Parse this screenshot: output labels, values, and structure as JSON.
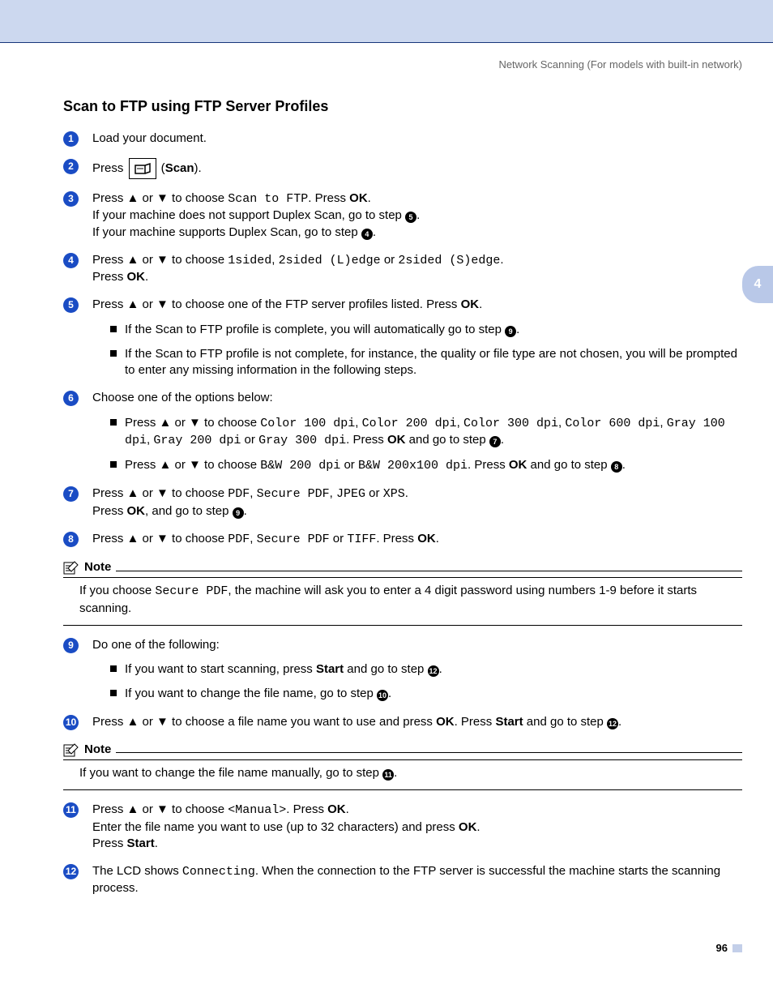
{
  "header": {
    "breadcrumb": "Network Scanning (For models with built-in network)"
  },
  "title": "Scan to FTP using FTP Server Profiles",
  "side_tab": "4",
  "page_number": "96",
  "labels": {
    "note": "Note",
    "press": "Press ",
    "scan": "Scan",
    "ok": "OK",
    "start": "Start"
  },
  "steps": {
    "s1": "Load your document.",
    "s2_scan_label": "Scan",
    "s3_a": "Press ▲ or ▼ to choose ",
    "s3_code1": "Scan to FTP",
    "s3_b": ". Press ",
    "s3_c": "If your machine does not support Duplex Scan, go to step ",
    "s3_d": "If your machine supports Duplex Scan, go to step ",
    "s4_a": "Press ▲ or ▼ to choose ",
    "s4_c1": "1sided",
    "s4_c2": "2sided (L)edge",
    "s4_c3": "2sided (S)edge",
    "s4_b": "Press ",
    "s5_a": "Press ▲ or ▼ to choose one of the FTP server profiles listed. Press ",
    "s5_sub1_a": "If the Scan to FTP profile is complete, you will automatically go to step ",
    "s5_sub2": "If the Scan to FTP profile is not complete, for instance, the quality or file type are not chosen, you will be prompted to enter any missing information in the following steps.",
    "s6_a": "Choose one of the options below:",
    "s6_sub1_a": "Press ▲ or ▼ to choose ",
    "s6_opts1": "Color 100 dpi",
    "s6_opts2": "Color 200 dpi",
    "s6_opts3": "Color 300 dpi",
    "s6_opts4": "Color 600 dpi",
    "s6_opts5": "Gray 100 dpi",
    "s6_opts6": "Gray 200 dpi",
    "s6_opts7": "Gray 300 dpi",
    "s6_sub1_b": ". Press ",
    "s6_sub1_c": " and go to step ",
    "s6_sub2_a": "Press ▲ or ▼ to choose ",
    "s6_opts8": "B&W 200 dpi",
    "s6_opts9": "B&W 200x100 dpi",
    "s7_a": "Press ▲ or ▼ to choose ",
    "s7_c1": "PDF",
    "s7_c2": "Secure PDF",
    "s7_c3": "JPEG",
    "s7_c4": "XPS",
    "s7_b": "Press ",
    "s7_c": ", and go to step ",
    "s8_a": "Press ▲ or ▼ to choose ",
    "s8_c1": "PDF",
    "s8_c2": "Secure PDF",
    "s8_c3": "TIFF",
    "s8_b": ". Press ",
    "note1_a": "If you choose ",
    "note1_code": "Secure PDF",
    "note1_b": ", the machine will ask you to enter a 4 digit password using numbers 1-9 before it starts scanning.",
    "s9_a": "Do one of the following:",
    "s9_sub1_a": "If you want to start scanning, press ",
    "s9_sub1_b": " and go to step ",
    "s9_sub2_a": "If you want to change the file name, go to step ",
    "s10_a": "Press ▲ or ▼ to choose a file name you want to use and press ",
    "s10_b": ". Press ",
    "s10_c": " and go to step ",
    "note2_a": "If you want to change the file name manually, go to step ",
    "s11_a": "Press ▲ or ▼ to choose ",
    "s11_code": "<Manual>",
    "s11_b": ". Press ",
    "s11_c": "Enter the file name you want to use (up to 32 characters) and press ",
    "s11_d": "Press ",
    "s12_a": "The LCD shows ",
    "s12_code": "Connecting",
    "s12_b": ". When the connection to the FTP server is successful the machine starts the scanning process."
  }
}
